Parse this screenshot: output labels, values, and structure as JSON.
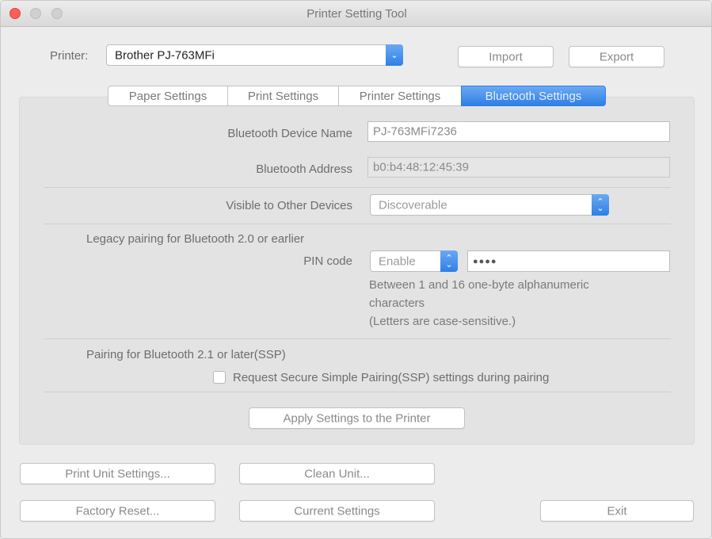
{
  "window": {
    "title": "Printer Setting Tool"
  },
  "printer": {
    "label": "Printer:",
    "value": "Brother PJ-763MFi",
    "import_label": "Import",
    "export_label": "Export"
  },
  "tabs": [
    {
      "label": "Paper Settings"
    },
    {
      "label": "Print Settings"
    },
    {
      "label": "Printer Settings"
    },
    {
      "label": "Bluetooth Settings"
    }
  ],
  "bluetooth": {
    "device_name_label": "Bluetooth Device Name",
    "device_name_value": "PJ-763MFi7236",
    "address_label": "Bluetooth Address",
    "address_value": "b0:b4:48:12:45:39",
    "visible_label": "Visible to Other Devices",
    "visible_value": "Discoverable",
    "legacy_label": "Legacy pairing for Bluetooth 2.0 or earlier",
    "pin_label": "PIN code",
    "pin_mode": "Enable",
    "pin_value": "●●●●",
    "pin_hint_1": "Between 1 and 16 one-byte alphanumeric",
    "pin_hint_2": "characters",
    "pin_hint_3": "(Letters are case-sensitive.)",
    "ssp_heading": "Pairing for Bluetooth 2.1 or later(SSP)",
    "ssp_checkbox_label": "Request Secure Simple Pairing(SSP) settings during pairing",
    "apply_label": "Apply Settings to the Printer"
  },
  "footer": {
    "print_unit_label": "Print Unit Settings...",
    "clean_unit_label": "Clean Unit...",
    "factory_reset_label": "Factory Reset...",
    "current_settings_label": "Current Settings",
    "exit_label": "Exit"
  },
  "colors": {
    "accent": "#2f7fe6",
    "close": "#fc5f57"
  },
  "icons": {
    "stepper": "chevron-up-down-icon"
  }
}
